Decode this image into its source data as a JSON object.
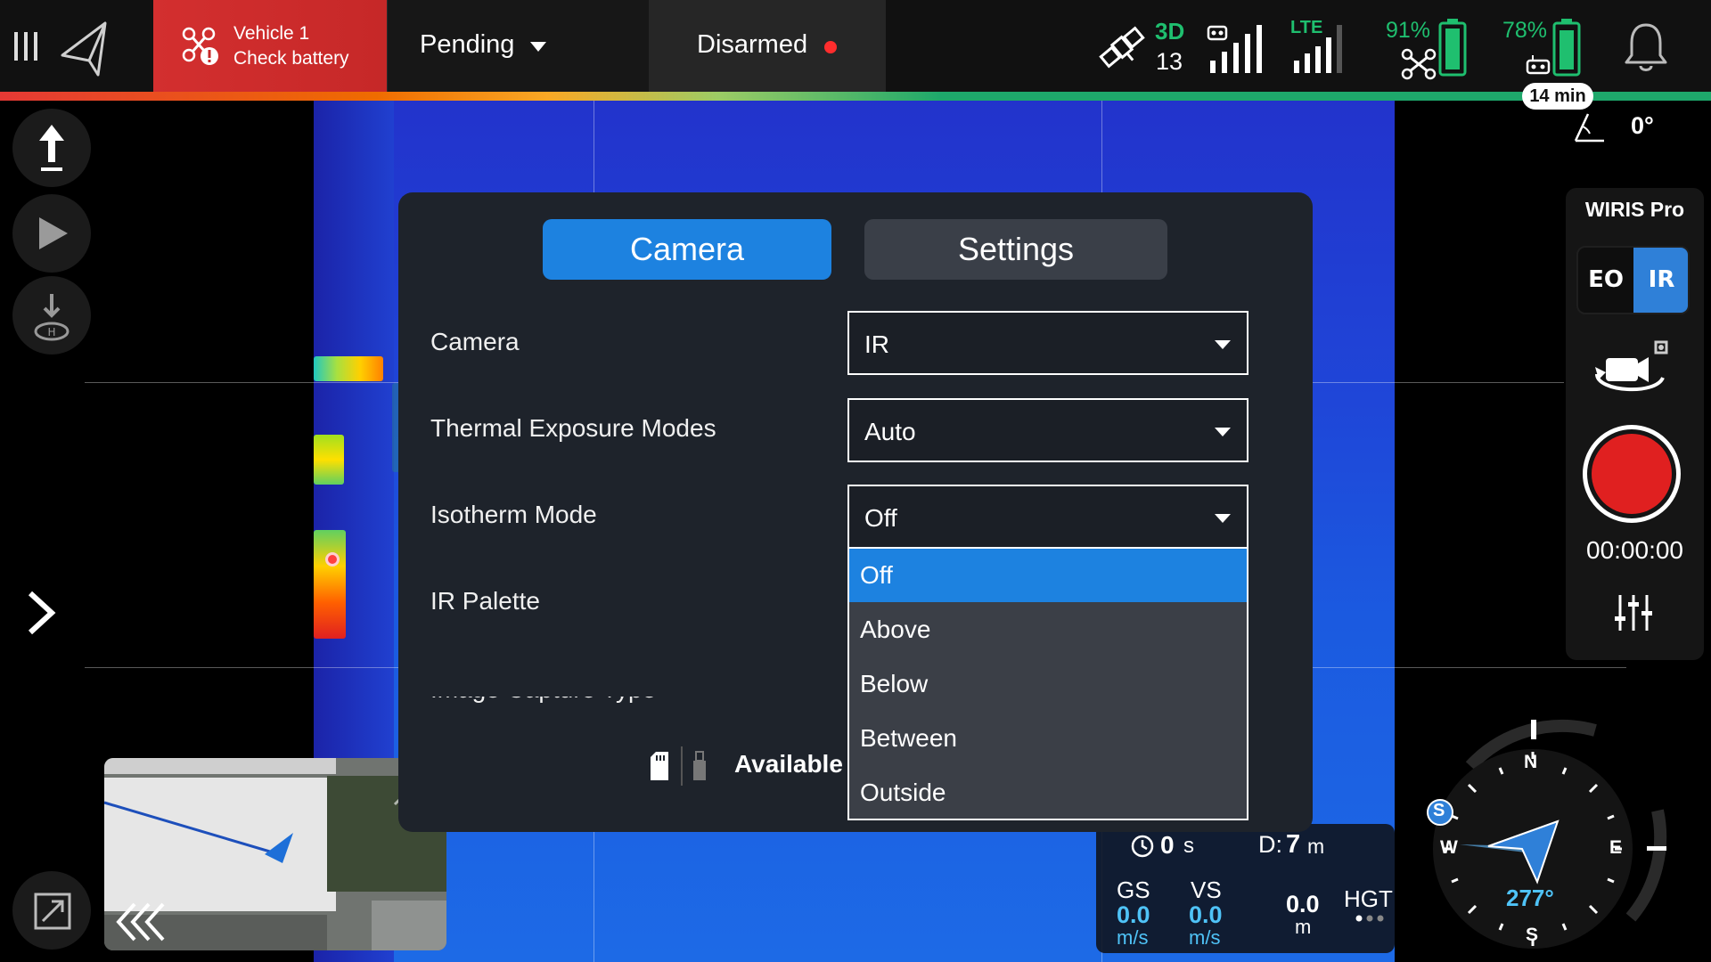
{
  "topbar": {
    "alert_line1": "Vehicle 1",
    "alert_line2": "Check battery",
    "flight_mode": "Pending",
    "arm_state": "Disarmed",
    "gps_fix": "3D",
    "satellites": "13",
    "lte_label": "LTE",
    "drone_battery": "91%",
    "controller_battery": "78%",
    "flight_time_remaining": "14 min",
    "gimbal_pitch": "0°"
  },
  "right_panel": {
    "camera_name": "WIRIS Pro",
    "eo_label": "EO",
    "ir_label": "IR",
    "record_time": "00:00:00"
  },
  "dialog": {
    "tabs": {
      "camera": "Camera",
      "settings": "Settings"
    },
    "rows": [
      {
        "label": "Camera",
        "value": "IR"
      },
      {
        "label": "Thermal Exposure Modes",
        "value": "Auto"
      },
      {
        "label": "Isotherm Mode",
        "value": "Off"
      },
      {
        "label": "IR Palette"
      },
      {
        "label": "Image Capture Type"
      }
    ],
    "dropdown_options": [
      "Off",
      "Above",
      "Below",
      "Between",
      "Outside"
    ],
    "dropdown_selected": "Off",
    "storage_status": "Available"
  },
  "telemetry": {
    "time_label": "0",
    "time_unit": "s",
    "distance_label": "D:",
    "distance_value": "7",
    "distance_unit": "m",
    "gs_label": "GS",
    "gs_value": "0.0",
    "gs_unit": "m/s",
    "vs_label": "VS",
    "vs_value": "0.0",
    "vs_unit": "m/s",
    "height_value": "0.0",
    "height_unit": "m",
    "height_label": "HGT"
  },
  "compass": {
    "heading": "277°",
    "n": "N",
    "e": "E",
    "s": "S",
    "w": "W",
    "marker": "S"
  },
  "colors": {
    "accent": "#1d82e0",
    "alert": "#d32f2f",
    "record": "#e02020",
    "telemetry_value": "#4fc3f7"
  }
}
